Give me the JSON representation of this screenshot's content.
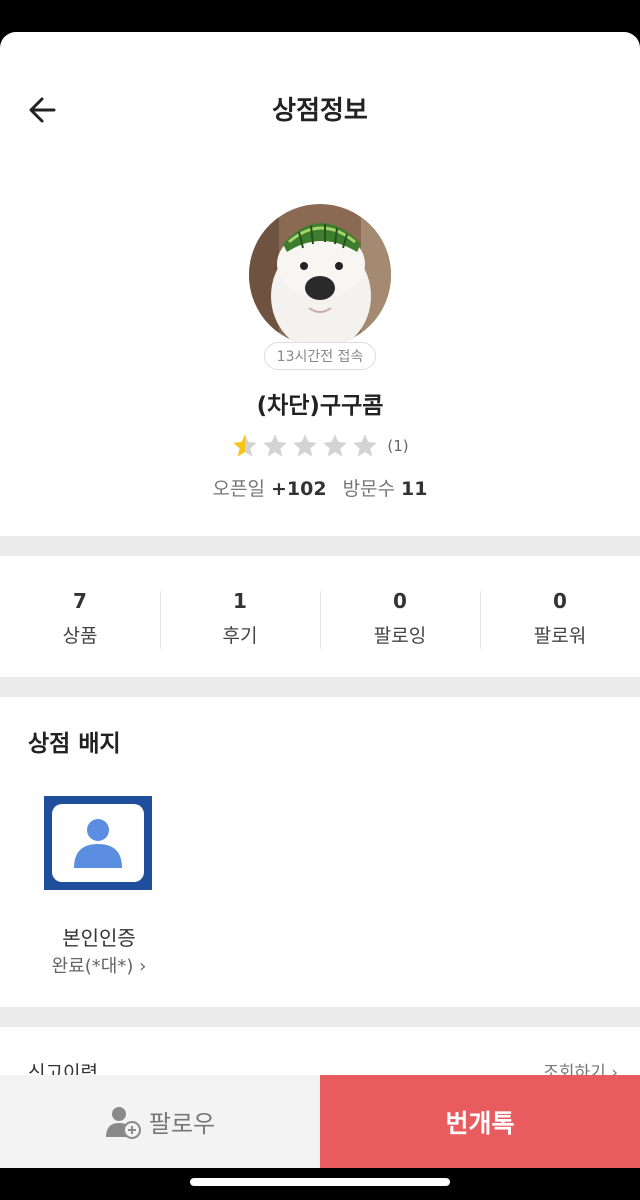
{
  "header": {
    "title": "상점정보",
    "back_icon": "arrow-left-icon"
  },
  "profile": {
    "last_access": "13시간전 접속",
    "name": "(차단)구구콤",
    "rating": 0.5,
    "rating_max": 5,
    "rating_count": "(1)",
    "open_label": "오픈일",
    "open_value": "+102",
    "visit_label": "방문수",
    "visit_value": "11"
  },
  "stats": [
    {
      "num": "7",
      "label": "상품"
    },
    {
      "num": "1",
      "label": "후기"
    },
    {
      "num": "0",
      "label": "팔로잉"
    },
    {
      "num": "0",
      "label": "팔로워"
    }
  ],
  "badges": {
    "title": "상점 배지",
    "items": [
      {
        "name": "본인인증",
        "status": "완료(*대*)"
      }
    ]
  },
  "report": {
    "label": "신고이력",
    "link": "조회하기"
  },
  "bottom_bar": {
    "follow_label": "팔로우",
    "follow_icon": "user-plus-icon",
    "chat_label": "번개톡"
  },
  "colors": {
    "accent": "#e85c60",
    "star": "#f5c518",
    "star_empty": "#d3d3d3",
    "badge_blue": "#1f4f9c"
  }
}
